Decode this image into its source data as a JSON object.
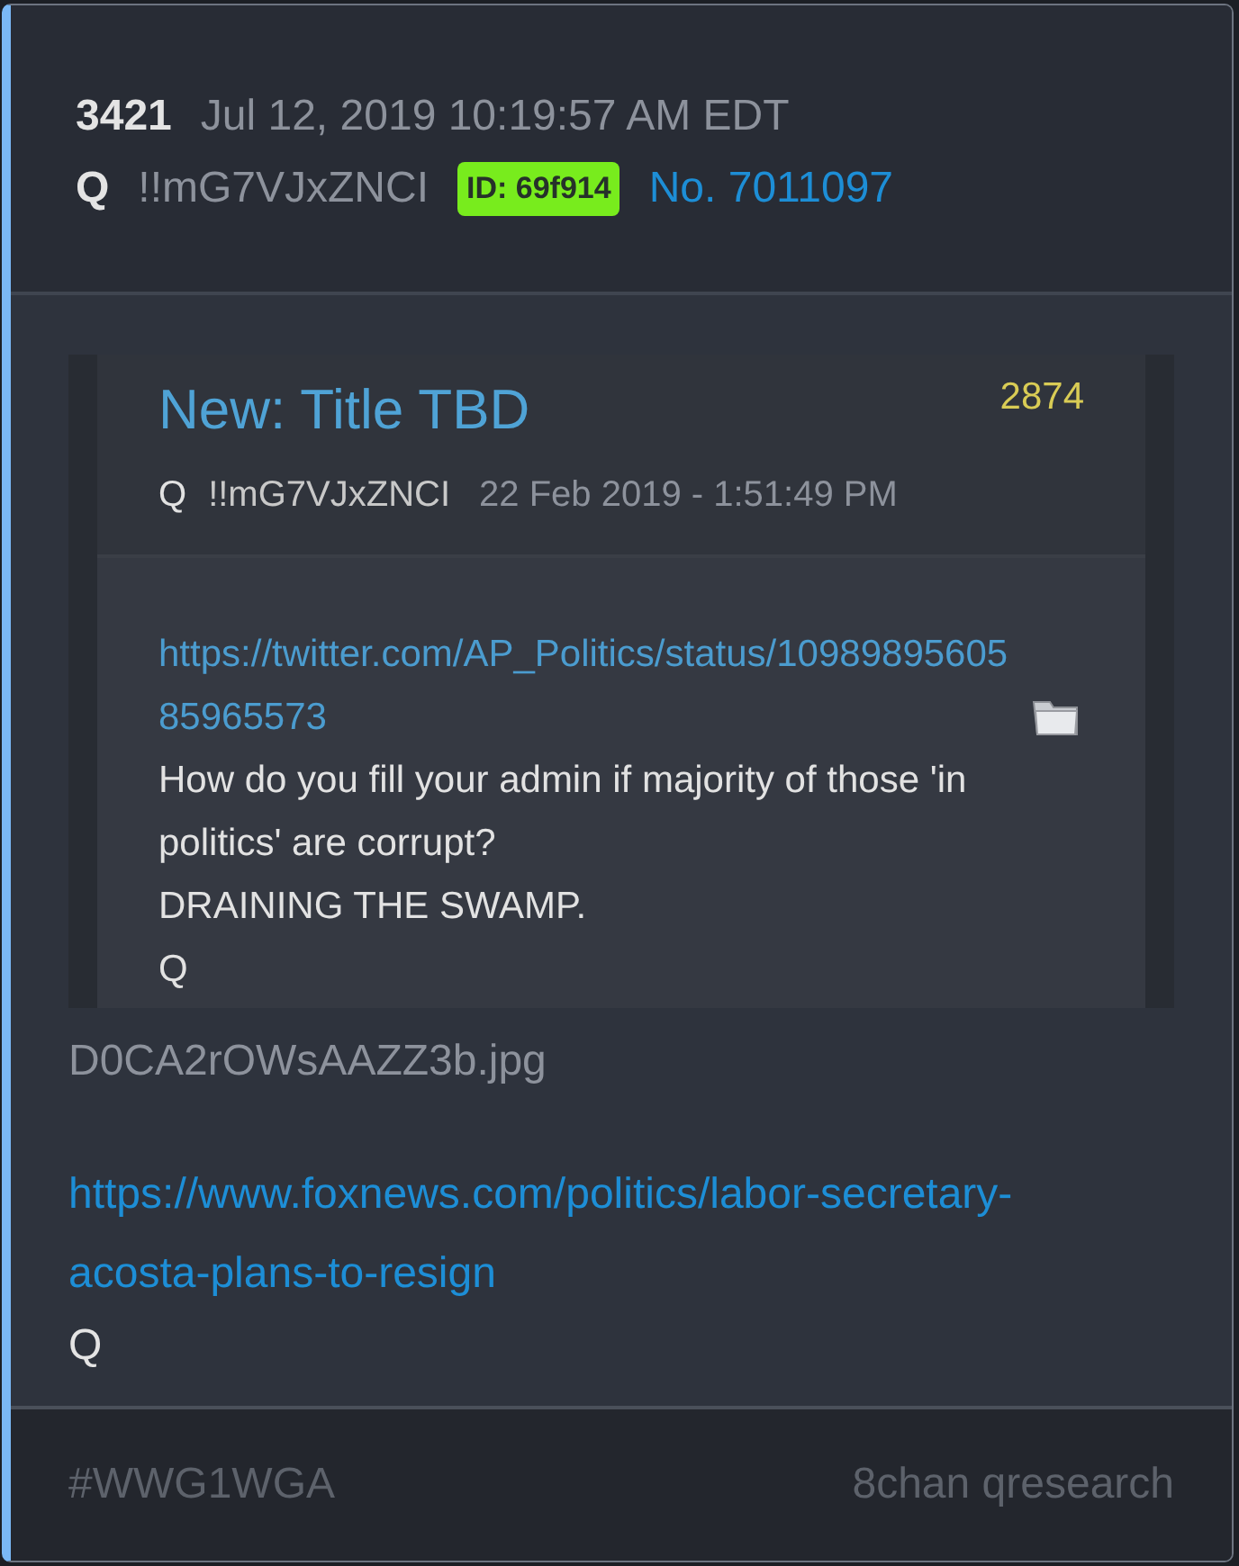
{
  "post": {
    "number": "3421",
    "timestamp": "Jul 12, 2019 10:19:57 AM EDT",
    "author": "Q",
    "tripcode": "!!mG7VJxZNCI",
    "id_badge": "ID: 69f914",
    "post_no": "No. 7011097"
  },
  "quote": {
    "title": "New: Title TBD",
    "count": "2874",
    "author": "Q",
    "tripcode": "!!mG7VJxZNCI",
    "date": "22 Feb 2019 - 1:51:49 PM",
    "link": "https://twitter.com/AP_Politics/status/1098989560585965573",
    "lines": [
      "How do you fill your admin if majority of those 'in politics' are corrupt?",
      "DRAINING THE SWAMP.",
      "Q"
    ]
  },
  "attachment": "D0CA2rOWsAAZZ3b.jpg",
  "link": "https://www.foxnews.com/politics/labor-secretary-acosta-plans-to-resign",
  "signature": "Q",
  "footer": {
    "hashtag": "#WWG1WGA",
    "source": "8chan qresearch"
  }
}
